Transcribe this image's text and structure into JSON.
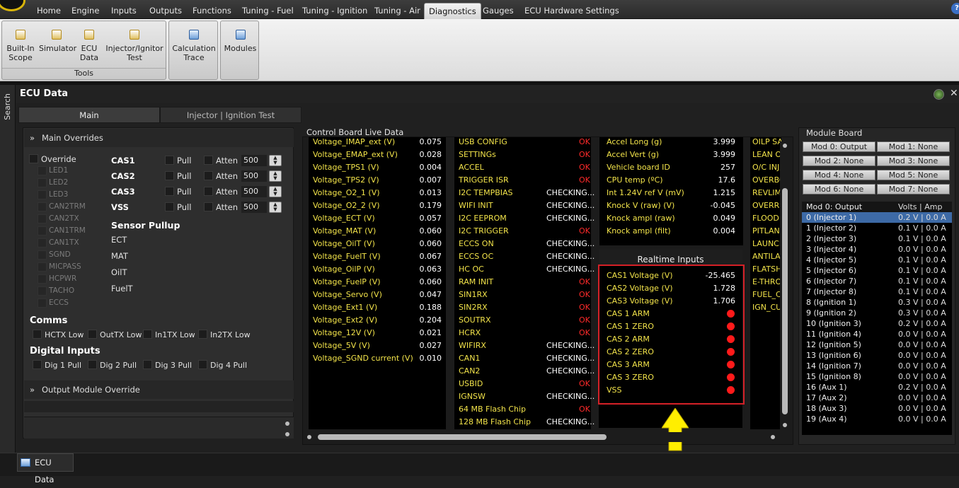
{
  "menu": {
    "tabs": [
      "Home",
      "Engine",
      "Inputs",
      "Outputs",
      "Functions",
      "Tuning - Fuel",
      "Tuning - Ignition",
      "Tuning - Air",
      "Diagnostics",
      "Gauges",
      "ECU Hardware Settings"
    ],
    "active_tab": "Diagnostics",
    "help_icon": "?"
  },
  "ribbon": {
    "tools_buttons": [
      {
        "label": "Built-In\nScope"
      },
      {
        "label": "Simulator"
      },
      {
        "label": "ECU\nData"
      },
      {
        "label": "Injector/Ignitor\nTest"
      }
    ],
    "tools_group_label": "Tools",
    "calc_button": "Calculation\nTrace",
    "modules_button": "Modules"
  },
  "sidebar": {
    "search_label": "Search"
  },
  "panel": {
    "title": "ECU Data",
    "tabs": [
      "Main",
      "Injector | Ignition Test"
    ],
    "active_tab": "Main"
  },
  "main_overrides": {
    "header": "Main Overrides",
    "override_label": "Override",
    "override_items": [
      "LED1",
      "LED2",
      "LED3",
      "CAN2TRM",
      "CAN2TX",
      "CAN1TRM",
      "CAN1TX",
      "SGND",
      "MICPASS",
      "HCPWR",
      "TACHO",
      "ECCS"
    ],
    "inputs": [
      {
        "name": "CAS1",
        "pull": "Pull",
        "atten": "Atten",
        "value": "500"
      },
      {
        "name": "CAS2",
        "pull": "Pull",
        "atten": "Atten",
        "value": "500"
      },
      {
        "name": "CAS3",
        "pull": "Pull",
        "atten": "Atten",
        "value": "500"
      },
      {
        "name": "VSS",
        "pull": "Pull",
        "atten": "Atten",
        "value": "500"
      }
    ],
    "sensor_pullup_title": "Sensor Pullup",
    "sensor_pullup": [
      "ECT",
      "MAT",
      "OilT",
      "FuelT"
    ],
    "comms_title": "Comms",
    "comms": [
      "HCTX Low",
      "OutTX Low",
      "In1TX Low",
      "In2TX Low"
    ],
    "digital_title": "Digital Inputs",
    "digital": [
      "Dig 1 Pull",
      "Dig 2 Pull",
      "Dig 3 Pull",
      "Dig 4 Pull"
    ],
    "output_module_header": "Output Module Override"
  },
  "control_board": {
    "title": "Control Board Live Data",
    "voltages": [
      {
        "name": "Voltage_IMAP_ext (V)",
        "value": "0.075"
      },
      {
        "name": "Voltage_EMAP_ext (V)",
        "value": "0.028"
      },
      {
        "name": "Voltage_TPS1 (V)",
        "value": "0.004"
      },
      {
        "name": "Voltage_TPS2 (V)",
        "value": "0.007"
      },
      {
        "name": "Voltage_O2_1 (V)",
        "value": "0.013"
      },
      {
        "name": "Voltage_O2_2 (V)",
        "value": "0.179"
      },
      {
        "name": "Voltage_ECT (V)",
        "value": "0.057"
      },
      {
        "name": "Voltage_MAT (V)",
        "value": "0.060"
      },
      {
        "name": "Voltage_OilT (V)",
        "value": "0.060"
      },
      {
        "name": "Voltage_FuelT (V)",
        "value": "0.067"
      },
      {
        "name": "Voltage_OilP (V)",
        "value": "0.063"
      },
      {
        "name": "Voltage_FuelP (V)",
        "value": "0.060"
      },
      {
        "name": "Voltage_Servo (V)",
        "value": "0.047"
      },
      {
        "name": "Voltage_Ext1 (V)",
        "value": "0.188"
      },
      {
        "name": "Voltage_Ext2 (V)",
        "value": "0.204"
      },
      {
        "name": "Voltage_12V (V)",
        "value": "0.021"
      },
      {
        "name": "Voltage_5V (V)",
        "value": "0.027"
      },
      {
        "name": "Voltage_SGND current (V)",
        "value": "0.010"
      }
    ],
    "status": [
      {
        "name": "USB CONFIG",
        "value": "OK",
        "color": "red"
      },
      {
        "name": "SETTINGs",
        "value": "OK",
        "color": "red"
      },
      {
        "name": "ACCEL",
        "value": "OK",
        "color": "red"
      },
      {
        "name": "TRIGGER ISR",
        "value": "OK",
        "color": "red"
      },
      {
        "name": "I2C TEMPBIAS",
        "value": "CHECKING...",
        "color": "white"
      },
      {
        "name": "WIFI INIT",
        "value": "CHECKING...",
        "color": "white"
      },
      {
        "name": "I2C EEPROM",
        "value": "CHECKING...",
        "color": "white"
      },
      {
        "name": "I2C TRIGGER",
        "value": "OK",
        "color": "red"
      },
      {
        "name": "ECCS ON",
        "value": "CHECKING...",
        "color": "white"
      },
      {
        "name": "ECCS OC",
        "value": "CHECKING...",
        "color": "white"
      },
      {
        "name": "HC OC",
        "value": "CHECKING...",
        "color": "white"
      },
      {
        "name": "RAM INIT",
        "value": "OK",
        "color": "red"
      },
      {
        "name": "SIN1RX",
        "value": "OK",
        "color": "red"
      },
      {
        "name": "SIN2RX",
        "value": "OK",
        "color": "red"
      },
      {
        "name": "SOUTRX",
        "value": "OK",
        "color": "red"
      },
      {
        "name": "HCRX",
        "value": "OK",
        "color": "red"
      },
      {
        "name": "WIFIRX",
        "value": "CHECKING...",
        "color": "white"
      },
      {
        "name": "CAN1",
        "value": "CHECKING...",
        "color": "white"
      },
      {
        "name": "CAN2",
        "value": "CHECKING...",
        "color": "white"
      },
      {
        "name": "USBID",
        "value": "OK",
        "color": "red"
      },
      {
        "name": "IGNSW",
        "value": "CHECKING...",
        "color": "white"
      },
      {
        "name": "64 MB Flash Chip",
        "value": "OK",
        "color": "red"
      },
      {
        "name": "128 MB Flash Chip",
        "value": "CHECKING...",
        "color": "white"
      }
    ],
    "vehicle": [
      {
        "name": "Accel Long (g)",
        "value": "3.999"
      },
      {
        "name": "Accel Vert (g)",
        "value": "3.999"
      },
      {
        "name": "Vehicle board ID",
        "value": "257"
      },
      {
        "name": "CPU temp (ºC)",
        "value": "17.6"
      },
      {
        "name": "Int 1.24V ref V (mV)",
        "value": "1.215"
      },
      {
        "name": "Knock V (raw) (V)",
        "value": "-0.045"
      },
      {
        "name": "Knock ampl (raw)",
        "value": "0.049"
      },
      {
        "name": "Knock ampl (filt)",
        "value": "0.004"
      }
    ],
    "realtime_title": "Realtime Inputs",
    "realtime": [
      {
        "name": "CAS1 Voltage (V)",
        "value": "-25.465"
      },
      {
        "name": "CAS2 Voltage (V)",
        "value": "1.728"
      },
      {
        "name": "CAS3 Voltage (V)",
        "value": "1.706"
      },
      {
        "name": "CAS 1 ARM",
        "value": ""
      },
      {
        "name": "CAS 1 ZERO",
        "value": ""
      },
      {
        "name": "CAS 2 ARM",
        "value": ""
      },
      {
        "name": "CAS 2 ZERO",
        "value": ""
      },
      {
        "name": "CAS 3 ARM",
        "value": ""
      },
      {
        "name": "CAS 3 ZERO",
        "value": ""
      },
      {
        "name": "VSS",
        "value": ""
      }
    ],
    "flags": [
      "OILP SA",
      "LEAN OU",
      "O/C INJ",
      "OVERBC",
      "REVLIMI",
      "OVERRU",
      "FLOOD C",
      "PITLANE",
      "LAUNCH",
      "ANTILAC",
      "FLATSH",
      "E-THRO",
      "FUEL_CU",
      "IGN_CU"
    ]
  },
  "module_board": {
    "title": "Module Board",
    "buttons": [
      "Mod 0: Output",
      "Mod 1: None",
      "Mod 2: None",
      "Mod 3: None",
      "Mod 4: None",
      "Mod 5: None",
      "Mod 6: None",
      "Mod 7: None"
    ],
    "table_headers": [
      "Mod 0: Output",
      "Volts | Amp"
    ],
    "rows": [
      {
        "name": "0 (Injector 1)",
        "value": "0.2 V | 0.0 A"
      },
      {
        "name": "1 (Injector 2)",
        "value": "0.1 V | 0.0 A"
      },
      {
        "name": "2 (Injector 3)",
        "value": "0.1 V | 0.0 A"
      },
      {
        "name": "3 (Injector 4)",
        "value": "0.0 V | 0.0 A"
      },
      {
        "name": "4 (Injector 5)",
        "value": "0.1 V | 0.0 A"
      },
      {
        "name": "5 (Injector 6)",
        "value": "0.1 V | 0.0 A"
      },
      {
        "name": "6 (Injector 7)",
        "value": "0.1 V | 0.0 A"
      },
      {
        "name": "7 (Injector 8)",
        "value": "0.1 V | 0.0 A"
      },
      {
        "name": "8 (Ignition 1)",
        "value": "0.3 V | 0.0 A"
      },
      {
        "name": "9 (Ignition 2)",
        "value": "0.3 V | 0.0 A"
      },
      {
        "name": "10 (Ignition 3)",
        "value": "0.2 V | 0.0 A"
      },
      {
        "name": "11 (Ignition 4)",
        "value": "0.0 V | 0.0 A"
      },
      {
        "name": "12 (Ignition 5)",
        "value": "0.0 V | 0.0 A"
      },
      {
        "name": "13 (Ignition 6)",
        "value": "0.0 V | 0.0 A"
      },
      {
        "name": "14 (Ignition 7)",
        "value": "0.0 V | 0.0 A"
      },
      {
        "name": "15 (Ignition 8)",
        "value": "0.0 V | 0.0 A"
      },
      {
        "name": "16 (Aux 1)",
        "value": "0.2 V | 0.0 A"
      },
      {
        "name": "17 (Aux 2)",
        "value": "0.0 V | 0.0 A"
      },
      {
        "name": "18 (Aux 3)",
        "value": "0.0 V | 0.0 A"
      },
      {
        "name": "19 (Aux 4)",
        "value": "0.0 V | 0.0 A"
      }
    ],
    "selected_row": 0
  },
  "bottom_tab": {
    "label": "ECU Data"
  },
  "colors": {
    "label_yellow": "#f2e34a",
    "ok_red": "#ff2a2a",
    "highlight_red": "#d42027",
    "arrow_yellow": "#ffee00",
    "selected_blue": "#3d6aa6"
  }
}
